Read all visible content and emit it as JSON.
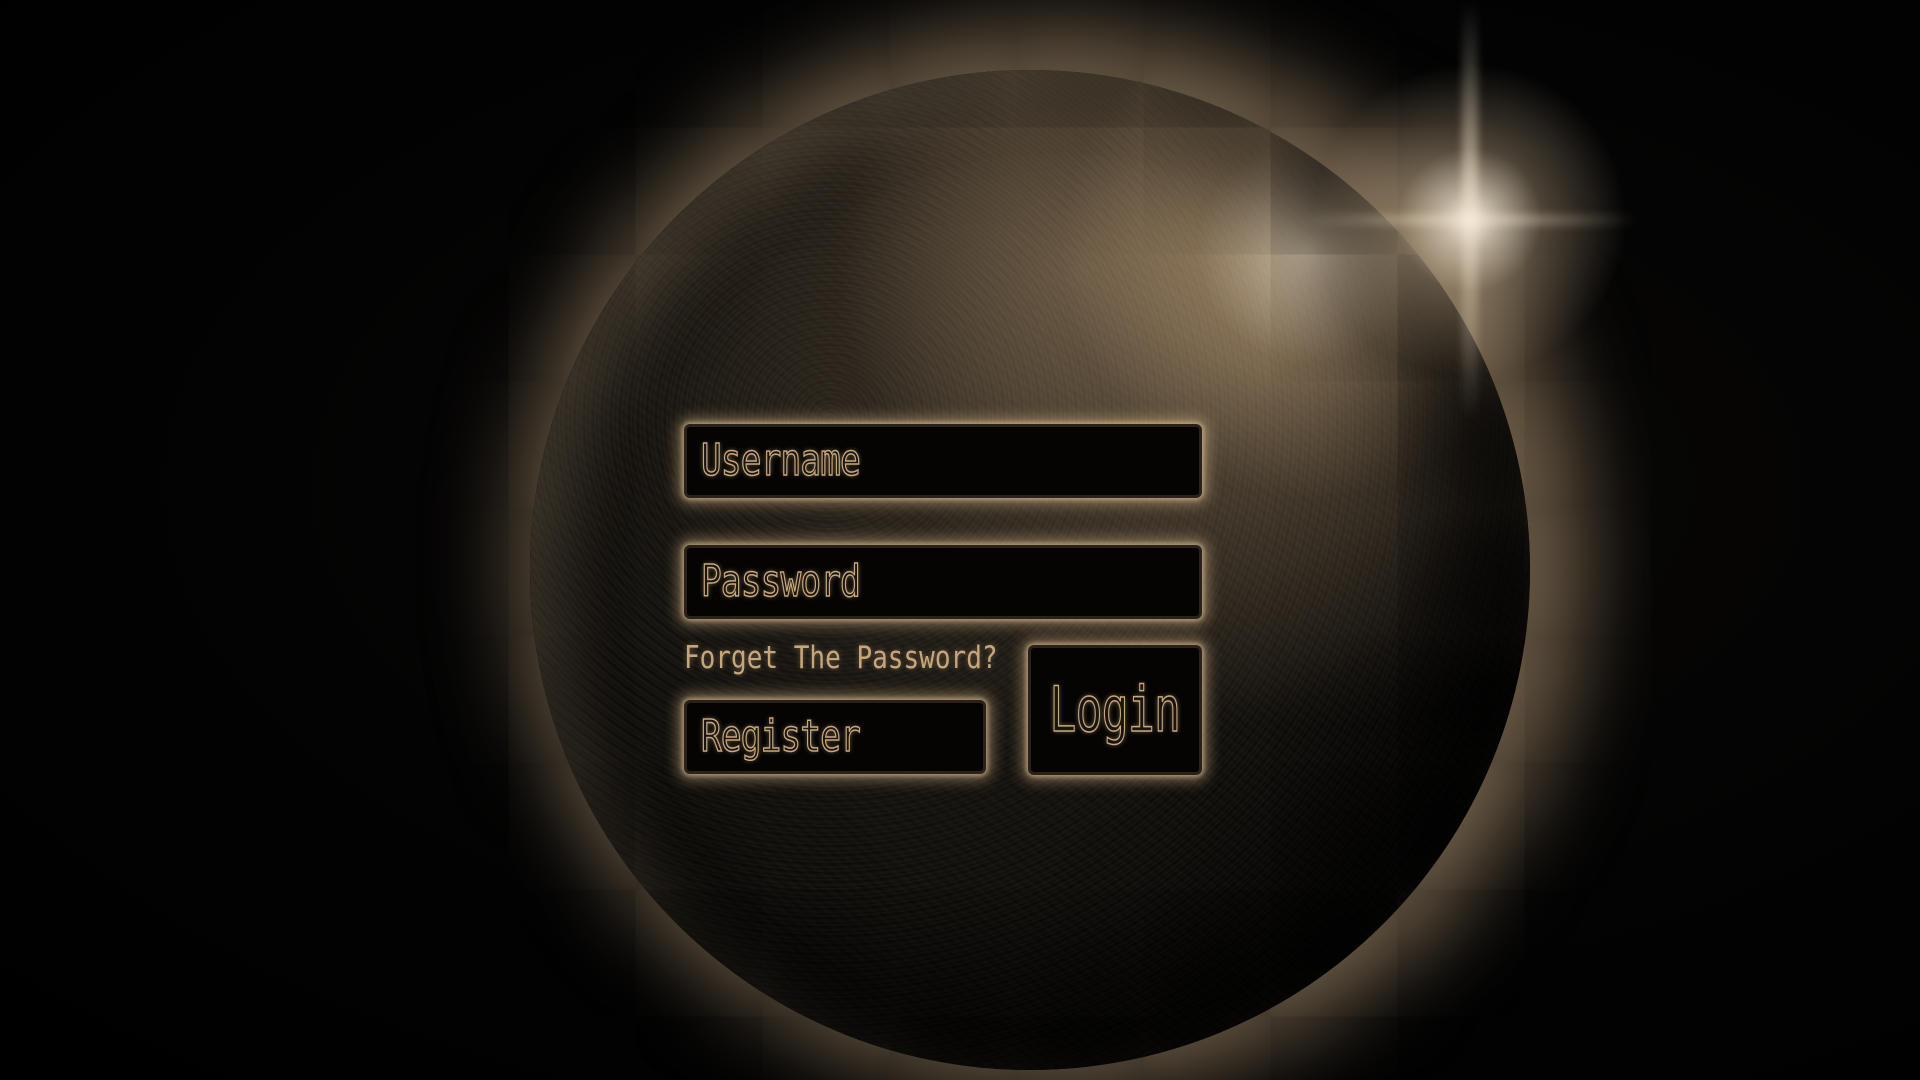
{
  "login_form": {
    "username_placeholder": "Username",
    "password_placeholder": "Password",
    "forgot_password_link": "Forget The Password?",
    "register_label": "Register",
    "login_label": "Login"
  },
  "theme": {
    "glow_color": "#c9a87c",
    "background_color": "#000000",
    "field_color": "#050403"
  },
  "background": {
    "subject": "planet-eclipse-icon"
  }
}
